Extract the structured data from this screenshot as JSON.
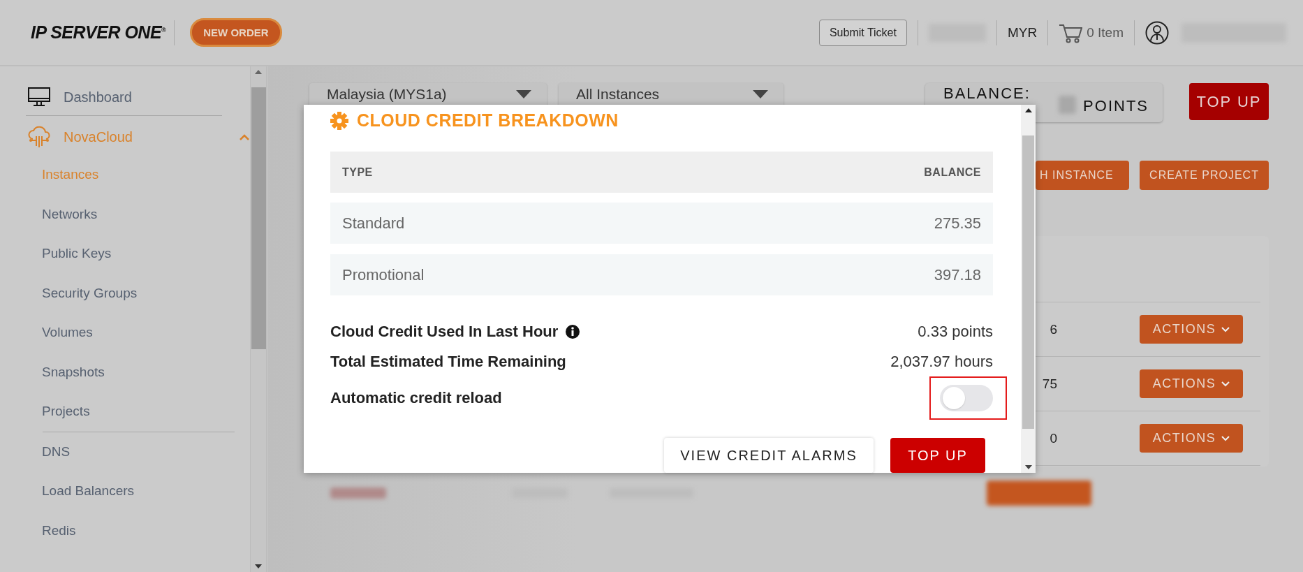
{
  "header": {
    "logo": "IP SERVER ONE",
    "logo_mark": "®",
    "new_order": "NEW ORDER",
    "submit_ticket": "Submit Ticket",
    "currency": "MYR",
    "cart": "0 Item"
  },
  "sidebar": {
    "items": [
      {
        "label": "Dashboard",
        "selected": false
      },
      {
        "label": "NovaCloud",
        "selected": true,
        "expanded": true,
        "children": [
          {
            "label": "Instances",
            "selected": true,
            "divider_above": false
          },
          {
            "label": "Networks",
            "selected": false,
            "divider_above": false
          },
          {
            "label": "Public Keys",
            "selected": false,
            "divider_above": false
          },
          {
            "label": "Security Groups",
            "selected": false,
            "divider_above": false
          },
          {
            "label": "Volumes",
            "selected": false,
            "divider_above": false
          },
          {
            "label": "Snapshots",
            "selected": false,
            "divider_above": false
          },
          {
            "label": "Projects",
            "selected": false,
            "divider_above": false
          },
          {
            "label": "DNS",
            "selected": false,
            "divider_above": true
          },
          {
            "label": "Load Balancers",
            "selected": false,
            "divider_above": false
          },
          {
            "label": "Redis",
            "selected": false,
            "divider_above": false
          }
        ]
      }
    ]
  },
  "toolbar": {
    "region": "Malaysia (MYS1a)",
    "filter": "All Instances",
    "balance_label": "BALANCE:",
    "balance_unit": "POINTS",
    "top_up": "TOP UP",
    "launch": "H INSTANCE",
    "create_project": "CREATE PROJECT"
  },
  "instances": {
    "rows": [
      {
        "cell": "6",
        "action": "ACTIONS"
      },
      {
        "cell": "75",
        "action": "ACTIONS"
      },
      {
        "cell": "0",
        "action": "ACTIONS"
      }
    ]
  },
  "modal": {
    "title": "CLOUD CREDIT BREAKDOWN",
    "table": {
      "columns": [
        "TYPE",
        "BALANCE"
      ],
      "rows": [
        [
          "Standard",
          "275.35"
        ],
        [
          "Promotional",
          "397.18"
        ]
      ]
    },
    "stats": [
      {
        "label": "Cloud Credit Used In Last Hour",
        "info": true,
        "value": "0.33 points"
      },
      {
        "label": "Total Estimated Time Remaining",
        "info": false,
        "value": "2,037.97 hours"
      }
    ],
    "auto_reload": {
      "label": "Automatic credit reload",
      "on": false,
      "highlighted": true
    },
    "buttons": [
      {
        "label": "VIEW CREDIT ALARMS",
        "kind": "secondary"
      },
      {
        "label": "TOP UP",
        "kind": "primary"
      }
    ]
  }
}
